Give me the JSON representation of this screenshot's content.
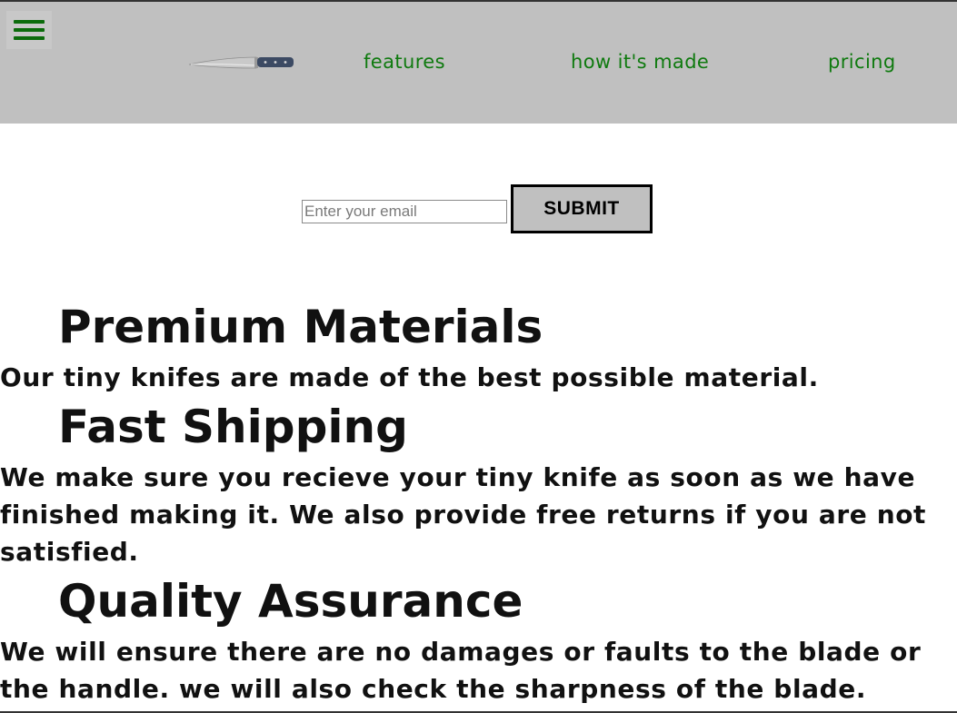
{
  "header": {
    "menu_icon": "hamburger-menu-icon",
    "logo_icon": "knife-icon",
    "nav": [
      {
        "label": "features"
      },
      {
        "label": "how it's made"
      },
      {
        "label": "pricing"
      }
    ],
    "nav_color": "#0f7a0f",
    "background": "#c0c0c0"
  },
  "form": {
    "email_placeholder": "Enter your email",
    "email_value": "",
    "submit_label": "SUBMIT"
  },
  "features": [
    {
      "title": "Premium Materials",
      "description": "Our tiny knifes are made of the best possible material."
    },
    {
      "title": "Fast Shipping",
      "description": "We make sure you recieve your tiny knife as soon as we have finished making it. We also provide free returns if you are not satisfied."
    },
    {
      "title": "Quality Assurance",
      "description": "We will ensure there are no damages or faults to the blade or the handle. we will also check the sharpness of the blade."
    }
  ]
}
